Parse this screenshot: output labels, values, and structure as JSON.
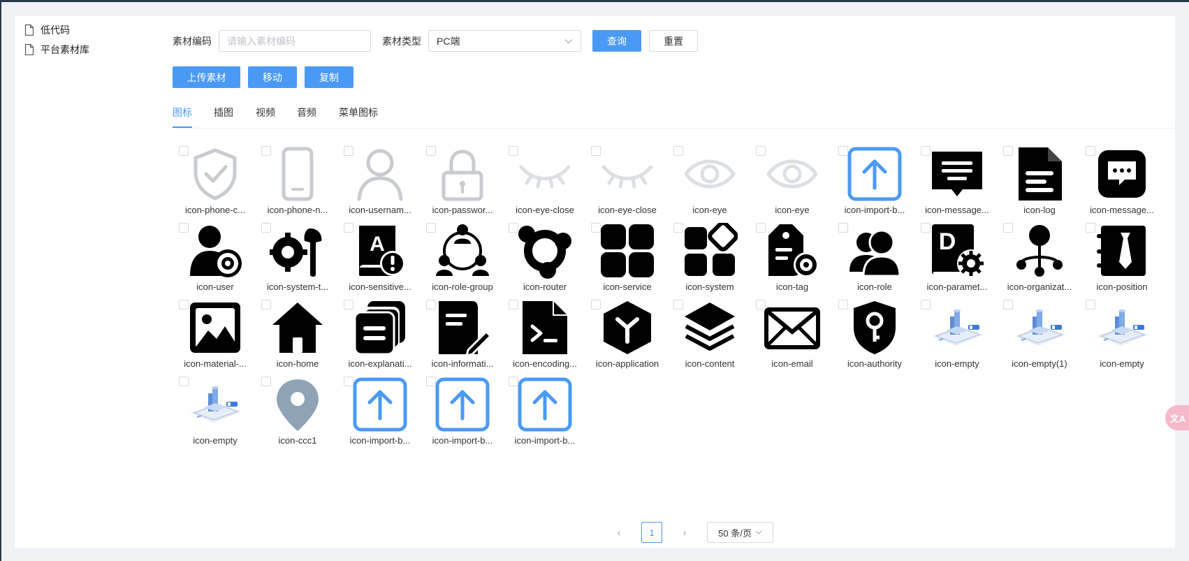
{
  "sidebar": {
    "items": [
      {
        "label": "低代码"
      },
      {
        "label": "平台素材库"
      }
    ]
  },
  "filters": {
    "code_label": "素材编码",
    "code_placeholder": "请输入素材编码",
    "code_value": "",
    "type_label": "素材类型",
    "type_value": "PC端",
    "search_label": "查询",
    "reset_label": "重置"
  },
  "actions": {
    "upload_label": "上传素材",
    "move_label": "移动",
    "copy_label": "复制"
  },
  "tabs": [
    {
      "label": "图标",
      "active": true
    },
    {
      "label": "插图",
      "active": false
    },
    {
      "label": "视频",
      "active": false
    },
    {
      "label": "音频",
      "active": false
    },
    {
      "label": "菜单图标",
      "active": false
    }
  ],
  "materials": [
    {
      "name": "icon-phone-c...",
      "icon": "shield-check-icon"
    },
    {
      "name": "icon-phone-n...",
      "icon": "phone-icon"
    },
    {
      "name": "icon-usernam...",
      "icon": "user-outline-icon"
    },
    {
      "name": "icon-passwor...",
      "icon": "lock-icon"
    },
    {
      "name": "icon-eye-close",
      "icon": "eye-close-icon"
    },
    {
      "name": "icon-eye-close",
      "icon": "eye-close-icon"
    },
    {
      "name": "icon-eye",
      "icon": "eye-icon"
    },
    {
      "name": "icon-eye",
      "icon": "eye-icon"
    },
    {
      "name": "icon-import-b...",
      "icon": "import-upload-icon"
    },
    {
      "name": "icon-message...",
      "icon": "message-icon"
    },
    {
      "name": "icon-log",
      "icon": "log-document-icon"
    },
    {
      "name": "icon-message...",
      "icon": "chat-bubble-icon"
    },
    {
      "name": "icon-user",
      "icon": "user-settings-icon"
    },
    {
      "name": "icon-system-t...",
      "icon": "system-tools-icon"
    },
    {
      "name": "icon-sensitive...",
      "icon": "sensitive-word-icon"
    },
    {
      "name": "icon-role-group",
      "icon": "role-group-icon"
    },
    {
      "name": "icon-router",
      "icon": "router-icon"
    },
    {
      "name": "icon-service",
      "icon": "service-grid-icon"
    },
    {
      "name": "icon-system",
      "icon": "system-blocks-icon"
    },
    {
      "name": "icon-tag",
      "icon": "tag-settings-icon"
    },
    {
      "name": "icon-role",
      "icon": "role-users-icon"
    },
    {
      "name": "icon-paramet...",
      "icon": "parameter-book-icon"
    },
    {
      "name": "icon-organizat...",
      "icon": "organization-icon"
    },
    {
      "name": "icon-position",
      "icon": "position-tie-icon"
    },
    {
      "name": "icon-material-...",
      "icon": "image-material-icon"
    },
    {
      "name": "icon-home",
      "icon": "home-icon"
    },
    {
      "name": "icon-explanati...",
      "icon": "explanation-docs-icon"
    },
    {
      "name": "icon-informati...",
      "icon": "information-edit-icon"
    },
    {
      "name": "icon-encoding...",
      "icon": "encoding-terminal-icon"
    },
    {
      "name": "icon-application",
      "icon": "application-hex-icon"
    },
    {
      "name": "icon-content",
      "icon": "content-layers-icon"
    },
    {
      "name": "icon-email",
      "icon": "email-icon"
    },
    {
      "name": "icon-authority",
      "icon": "authority-shield-icon"
    },
    {
      "name": "icon-empty",
      "icon": "empty-illustration-icon"
    },
    {
      "name": "icon-empty(1)",
      "icon": "empty-illustration-icon"
    },
    {
      "name": "icon-empty",
      "icon": "empty-illustration-icon"
    },
    {
      "name": "icon-empty",
      "icon": "empty-illustration-icon"
    },
    {
      "name": "icon-ccc1",
      "icon": "map-pin-icon"
    },
    {
      "name": "icon-import-b...",
      "icon": "import-upload-icon"
    },
    {
      "name": "icon-import-b...",
      "icon": "import-upload-icon"
    },
    {
      "name": "icon-import-b...",
      "icon": "import-upload-icon"
    }
  ],
  "pagination": {
    "prev": "‹",
    "current_page": "1",
    "next": "›",
    "page_size": "50 条/页"
  },
  "colors": {
    "primary": "#4a9af5",
    "icon_black": "#000000",
    "icon_gray": "#c8cbd0",
    "icon_light": "#dcdfe4",
    "pin_gray": "#8fa3b7"
  },
  "floating_badge": "文A"
}
